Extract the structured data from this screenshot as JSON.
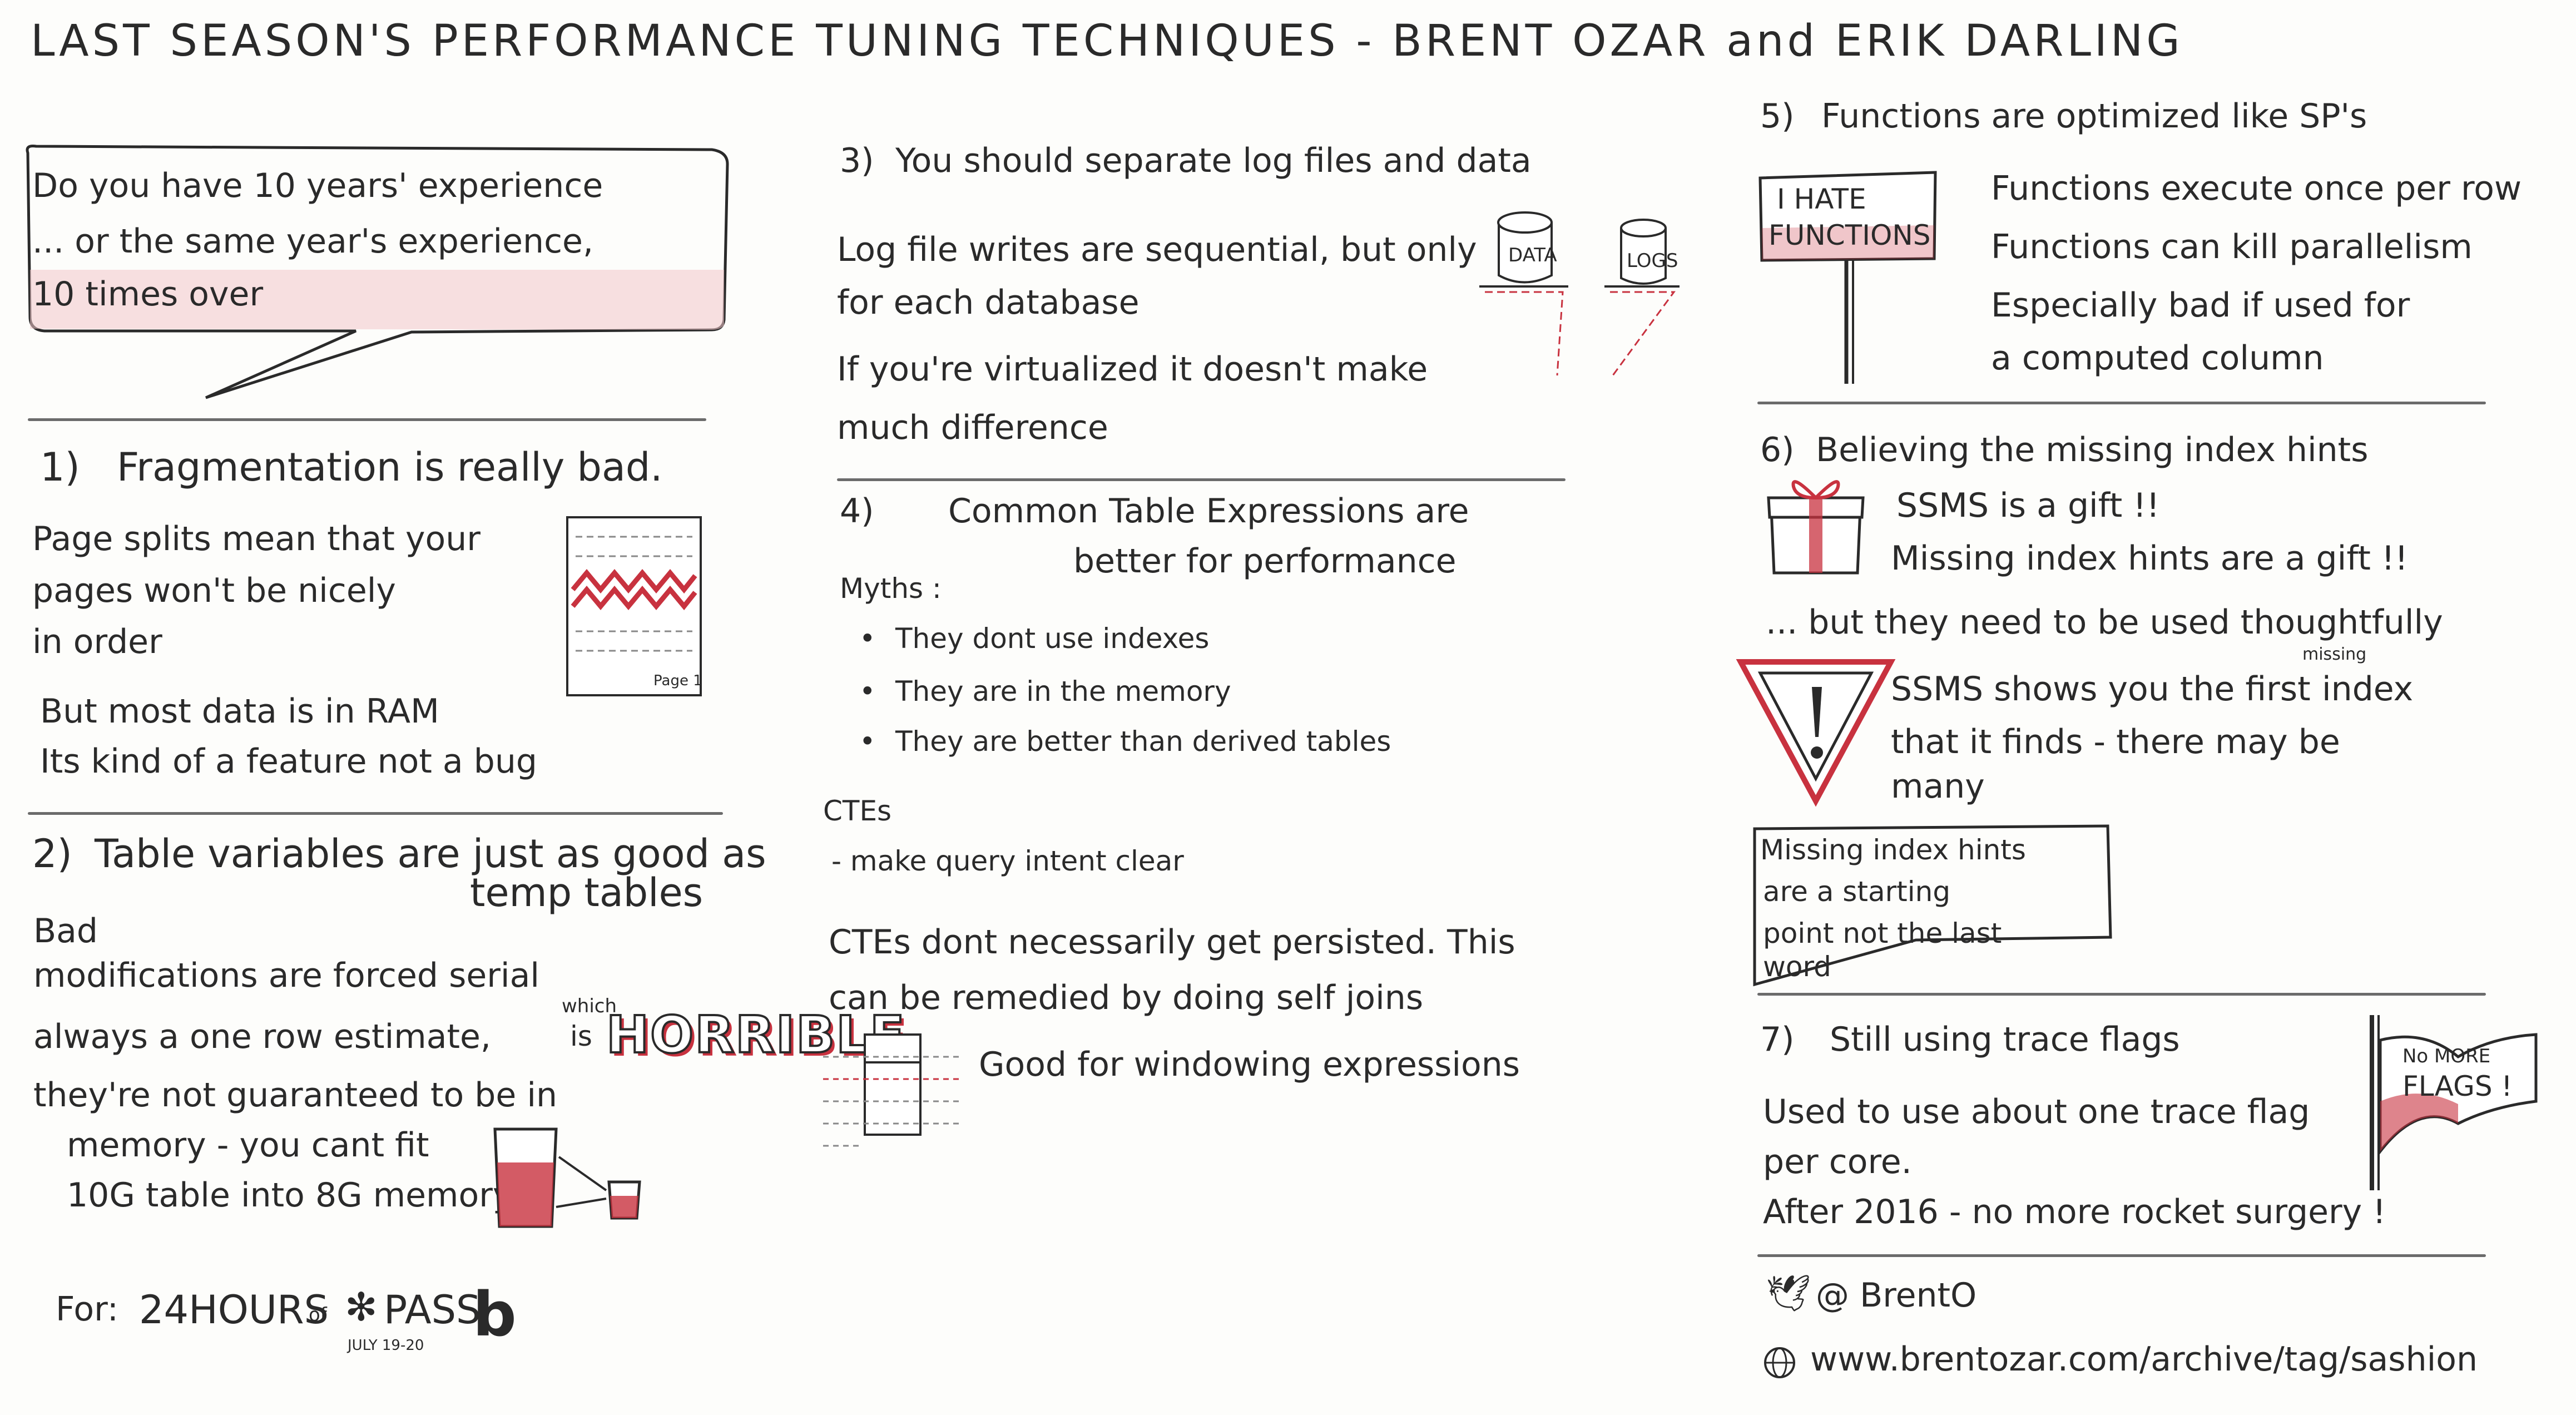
{
  "title": "LAST SEASON'S   PERFORMANCE TUNING TECHNIQUES  -  BRENT OZAR  and  ERIK DARLING",
  "intro": {
    "line1": "Do you have 10 years' experience",
    "line2": "... or the same year's experience,",
    "line3": "10 times over"
  },
  "s1": {
    "num": "1)",
    "heading": "Fragmentation is really bad.",
    "body1": "Page splits mean that your",
    "body2": "pages won't be nicely",
    "body3": "in order",
    "bullet1": "But most data is in RAM",
    "bullet2": "Its kind of a feature not a bug",
    "page_label": "Page 1"
  },
  "s2": {
    "num": "2)",
    "heading": "Table variables are just as good as",
    "heading2": "temp tables",
    "bad": "Bad",
    "b1": "modifications are forced serial",
    "b2": "always a one row estimate,",
    "which": "which",
    "is": "is",
    "horrible": "HORRIBLE",
    "b3": "they're not guaranteed to be in",
    "b3b": "memory - you cant fit",
    "b3c": "10G table into 8G memory"
  },
  "footer": {
    "for": "For:",
    "event": "24HOURS",
    "of": "of",
    "pass": "PASS",
    "dates": "JULY 19-20"
  },
  "s3": {
    "num": "3)",
    "heading": "You should separate log files and data",
    "p1a": "Log file writes are sequential, but only",
    "p1b": "for each database",
    "p2a": "If you're virtualized it doesn't make",
    "p2b": "much difference",
    "data_label": "DATA",
    "logs_label": "LOGS"
  },
  "s4": {
    "num": "4)",
    "heading": "Common Table Expressions are",
    "heading2": "better for performance",
    "myths": "Myths :",
    "m1": "They dont use indexes",
    "m2": "They are in the memory",
    "m3": "They are better than derived tables",
    "ctes": "CTEs",
    "ctes_line": "- make query intent clear",
    "p1": "CTEs dont necessarily get persisted. This",
    "p2": "can be remedied by doing self joins",
    "good": "Good for windowing expressions"
  },
  "s5": {
    "num": "5)",
    "heading": "Functions are optimized like SP's",
    "sign1": "I HATE",
    "sign2": "FUNCTIONS",
    "l1": "Functions execute once per row",
    "l2": "Functions can kill parallelism",
    "l3": "Especially bad if used for",
    "l4": "a computed column"
  },
  "s6": {
    "num": "6)",
    "heading": "Believing the missing index hints",
    "gift1": "SSMS is a gift !!",
    "gift2": "Missing index hints are a gift !!",
    "but": "... but they need to be used thoughtfully",
    "warn1": "SSMS shows you the first",
    "missing": "missing",
    "index": "index",
    "warn2": "that it finds - there may be",
    "warn3": "many",
    "box1": "Missing index hints",
    "box2": "are a starting",
    "box3": "point not the last",
    "box4": "word"
  },
  "s7": {
    "num": "7)",
    "heading": "Still using trace flags",
    "l1": "Used to use about one trace flag",
    "l2": "per core.",
    "l3": "After 2016 - no more rocket surgery !",
    "flag1": "No MORE",
    "flag2": "FLAGS !"
  },
  "contact": {
    "twitter": "@ BrentO",
    "url": "www.brentozar.com/archive/tag/sashion"
  },
  "colors": {
    "accent_red": "#c8323f",
    "ink": "#2a2a2a",
    "paper": "#fdfdfb"
  }
}
